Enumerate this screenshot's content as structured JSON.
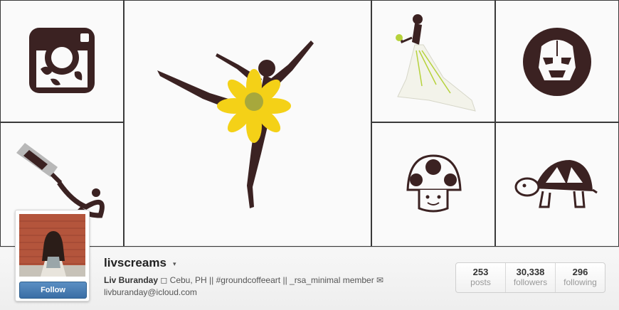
{
  "profile": {
    "username": "livscreams",
    "caret": "▾",
    "full_name": "Liv Buranday",
    "bio_rest": "◻ Cebu, PH || #groundcoffeeart || _rsa_minimal member ✉",
    "email": "livburanday@icloud.com",
    "follow_label": "Follow"
  },
  "stats": [
    {
      "value": "253",
      "label": "posts"
    },
    {
      "value": "30,338",
      "label": "followers"
    },
    {
      "value": "296",
      "label": "following"
    }
  ],
  "tiles": [
    {
      "icon": "camera-logo-art"
    },
    {
      "icon": "ballerina-flower-art"
    },
    {
      "icon": "bride-gown-art"
    },
    {
      "icon": "stormtrooper-badge-art"
    },
    {
      "icon": "paint-tube-art"
    },
    {
      "icon": "mushroom-art"
    },
    {
      "icon": "turtle-art"
    }
  ],
  "colors": {
    "coffee": "#3b2222",
    "flower": "#f4d117",
    "follow": "#3a6ea5"
  }
}
